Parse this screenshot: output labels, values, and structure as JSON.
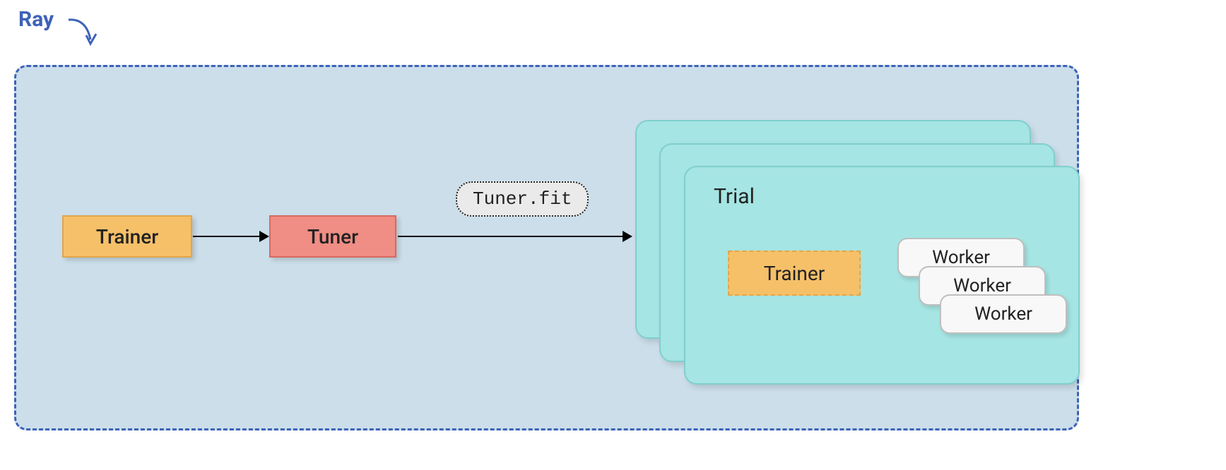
{
  "title": "Ray",
  "boxes": {
    "trainer": "Trainer",
    "tuner": "Tuner",
    "tuner_fit": "Tuner.fit",
    "trial": "Trial",
    "inner_trainer": "Trainer",
    "worker1": "Worker",
    "worker2": "Worker",
    "worker3": "Worker"
  },
  "colors": {
    "ray_border": "#3d62b8",
    "ray_bg": "#cbdeea",
    "trainer_bg": "#f6c069",
    "tuner_bg": "#f08d84",
    "trial_bg": "#a5e5e3",
    "worker_bg": "#f8f8f8"
  }
}
